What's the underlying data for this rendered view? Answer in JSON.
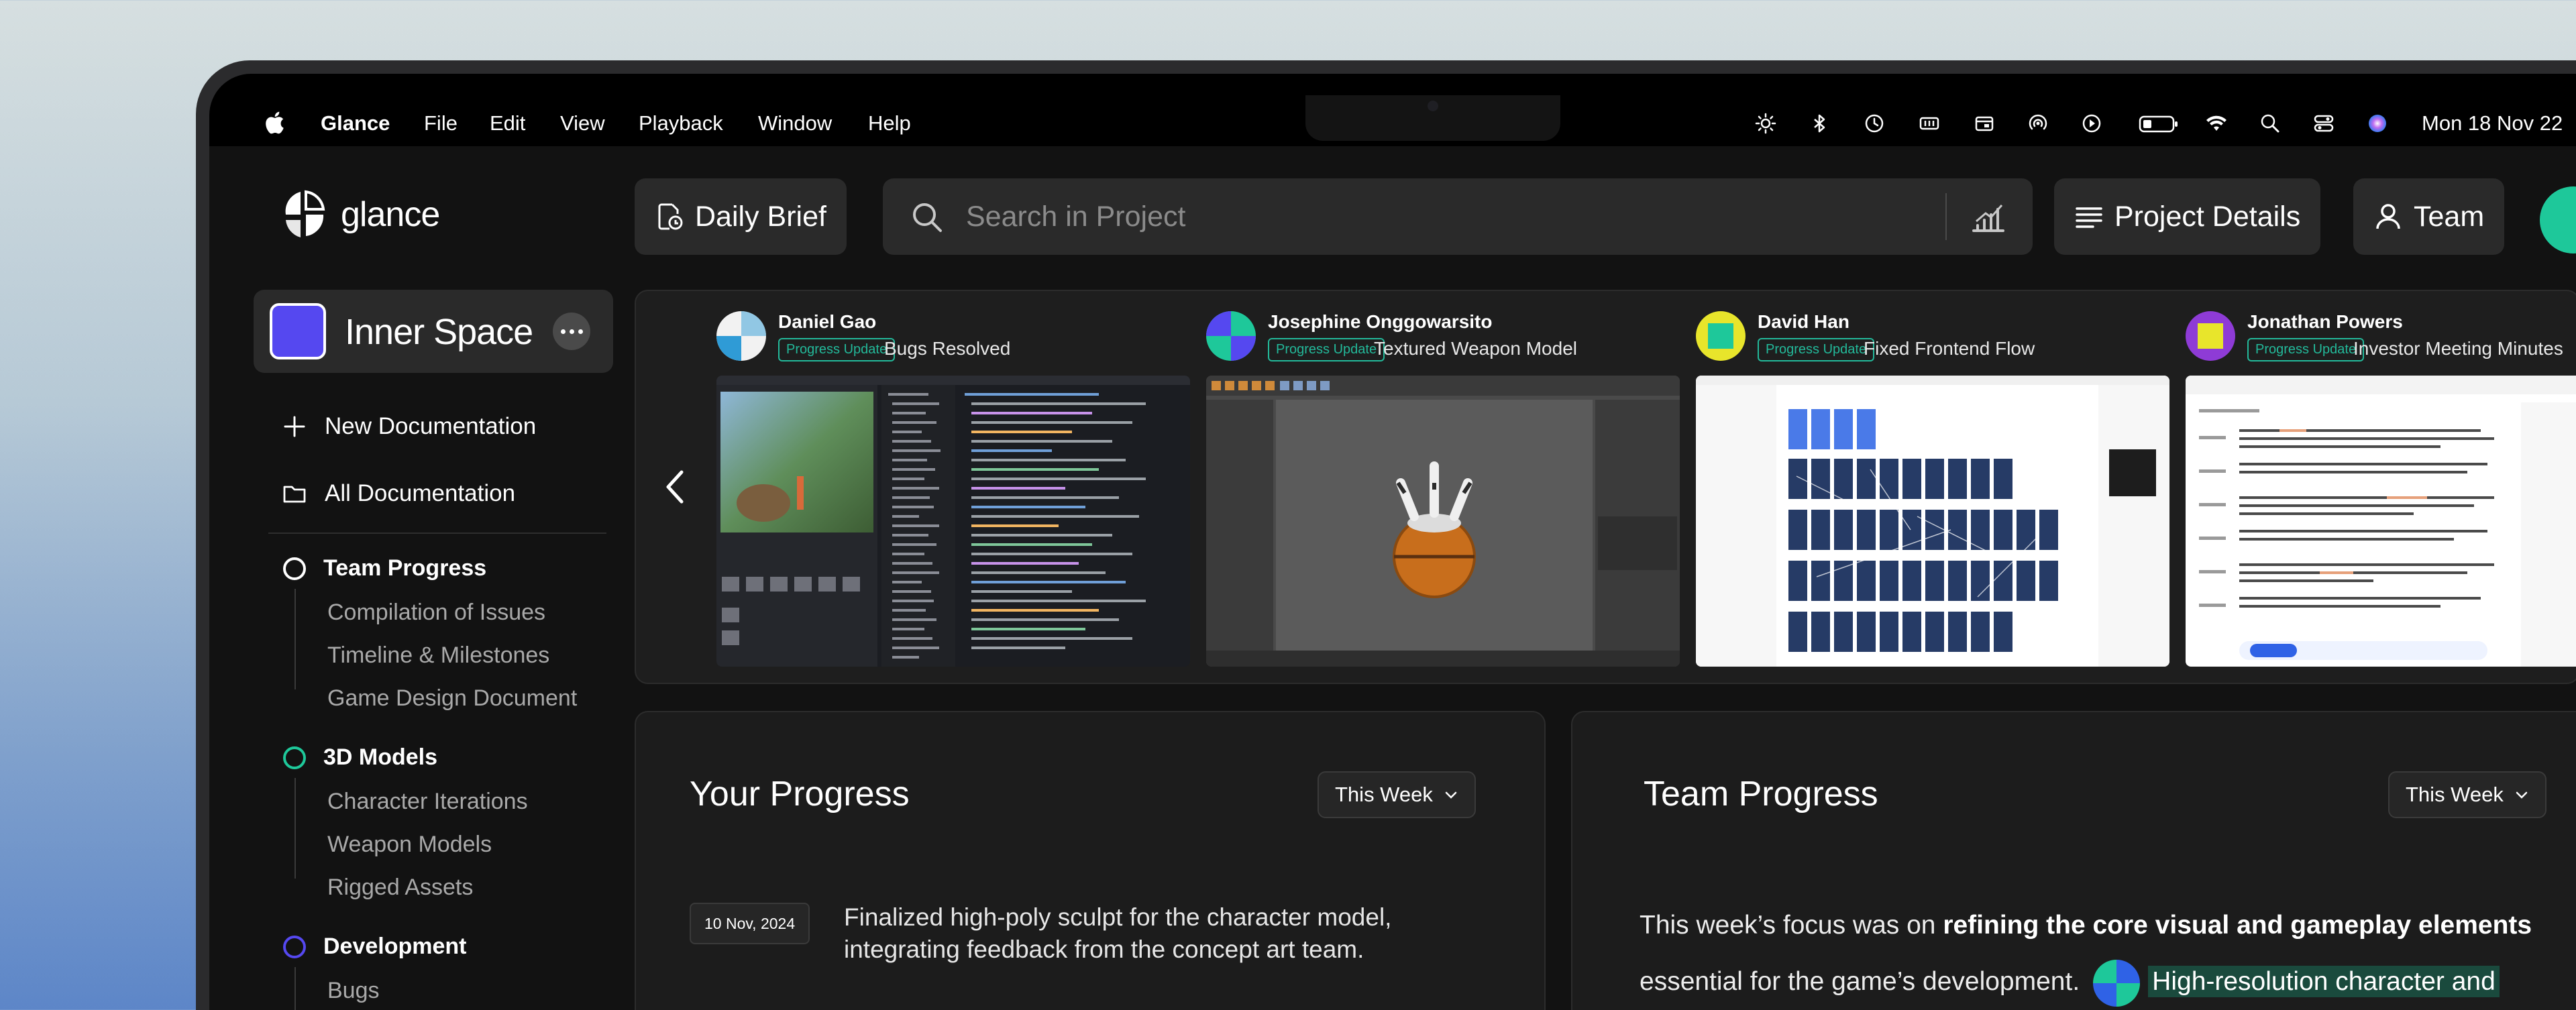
{
  "menubar": {
    "app_name": "Glance",
    "items": [
      "File",
      "Edit",
      "View",
      "Playback",
      "Window",
      "Help"
    ],
    "clock": "Mon 18 Nov  22"
  },
  "brand": {
    "name": "glance"
  },
  "toolbar": {
    "daily_brief": "Daily Brief",
    "search_placeholder": "Search in Project",
    "project_details": "Project Details",
    "team": "Team"
  },
  "workspace": {
    "name": "Inner Space"
  },
  "sidebar": {
    "new_doc": "New Documentation",
    "all_docs": "All Documentation",
    "sections": [
      {
        "title": "Team Progress",
        "ring_color": "#ffffff",
        "items": [
          "Compilation of Issues",
          "Timeline & Milestones",
          "Game Design Document"
        ]
      },
      {
        "title": "3D Models",
        "ring_color": "#1ec89a",
        "items": [
          "Character Iterations",
          "Weapon Models",
          "Rigged Assets"
        ]
      },
      {
        "title": "Development",
        "ring_color": "#5548f0",
        "items": [
          "Bugs"
        ]
      }
    ]
  },
  "updates": [
    {
      "name": "Daniel Gao",
      "tag": "Progress Update",
      "title": "Bugs Resolved",
      "avatar_colors": [
        "#2f9bd6",
        "#f2f2f2"
      ]
    },
    {
      "name": "Josephine Onggowarsito",
      "tag": "Progress Update",
      "title": "Textured Weapon Model",
      "avatar_colors": [
        "#1ec89a",
        "#5548f0"
      ]
    },
    {
      "name": "David Han",
      "tag": "Progress Update",
      "title": "Fixed Frontend Flow",
      "avatar_colors": [
        "#e8e52b",
        "#1ec89a"
      ]
    },
    {
      "name": "Jonathan Powers",
      "tag": "Progress Update",
      "title": "Investor Meeting Minutes",
      "avatar_colors": [
        "#8e3bd6",
        "#e8e52b"
      ]
    }
  ],
  "your_progress": {
    "title": "Your Progress",
    "period": "This Week",
    "entries": [
      {
        "date": "10 Nov, 2024",
        "text": "Finalized high-poly sculpt for the character model, integrating feedback from the concept art team."
      }
    ]
  },
  "team_progress": {
    "title": "Team Progress",
    "period": "This Week",
    "lead": "This week’s focus was on ",
    "bold": "refining the core visual and gameplay elements",
    "rest": "essential for the game’s development.",
    "highlight": "High-resolution character and"
  },
  "colors": {
    "accent": "#1ec89a",
    "workspace": "#5548f0",
    "tag": "#23b99a"
  }
}
